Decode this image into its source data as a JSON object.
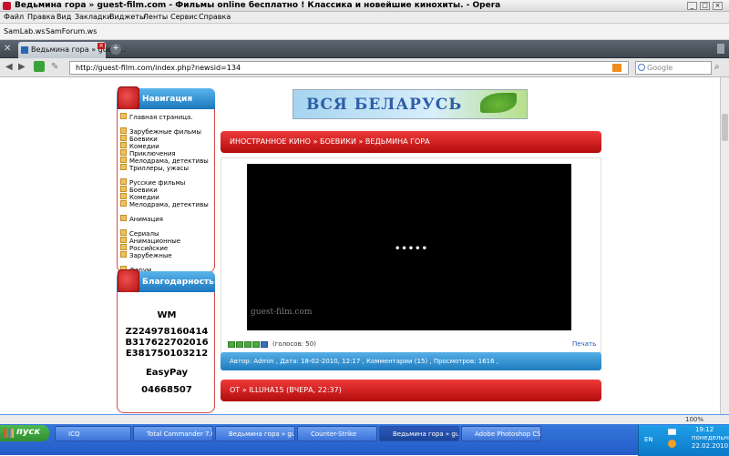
{
  "window": {
    "title": "Ведьмина гора » guest-film.com - Фильмы online бесплатно ! Классика и новейшие кинохиты. - Opera"
  },
  "menu": [
    "Файл",
    "Правка",
    "Вид",
    "Закладки",
    "Виджеты",
    "Ленты",
    "Сервис",
    "Справка"
  ],
  "bookmarks": [
    "SamLab.ws",
    "SamForum.ws"
  ],
  "tab": {
    "label": "Ведьмина гора » guest..."
  },
  "address": {
    "url": "http://guest-film.com/index.php?newsid=134",
    "search_placeholder": "Google"
  },
  "nav": {
    "title": "Навигация",
    "items": [
      "Главная страница.",
      "",
      "Зарубежные фильмы",
      "Боевики",
      "Комедии",
      "Приключения",
      "Мелодрама, детективы",
      "Триллеры, ужасы",
      "",
      "Русские фильмы",
      "Боевики",
      "Комедии",
      "Мелодрама, детективы",
      "",
      "Анимация",
      "",
      "Сериалы",
      "Анимационные",
      "Российские",
      "Зарубежные",
      "",
      "Форум"
    ]
  },
  "thanks": {
    "title": "Благодарность",
    "wm": "WM",
    "purse1": "Z224978160414",
    "purse2": "B317622702016",
    "purse3": "E381750103212",
    "easypay": "EasyPay",
    "easypay_num": "04668507"
  },
  "banner": {
    "text": "ВСЯ БЕЛАРУСЬ"
  },
  "breadcrumb": "ИНОСТРАННОЕ КИНО » БОЕВИКИ » ВЕДЬМИНА ГОРА",
  "video": {
    "loading": "•••••",
    "watermark": "guest-film.com"
  },
  "rating": {
    "votes": "(голосов: 50)",
    "print": "Печать",
    "stars": 5
  },
  "meta": "Автор: Admin , Дата: 18-02-2010, 12:17 , Комментарии (15) , Просмотров: 1616 ,",
  "comment_bar": "ОТ » ILLUHA15 (ВЧЕРА, 22:37)",
  "status": {
    "zoom": "100%"
  },
  "taskbar": {
    "start": "пуск",
    "tasks": [
      "ICQ",
      "Total Commander 7.0...",
      "Ведьмина гора » gu...",
      "Counter-Strike",
      "Ведьмина гора » gu...",
      "Adobe Photoshop CS4"
    ],
    "lang": "EN",
    "time": "19:12",
    "day": "понедельник",
    "date": "22.02.2010"
  }
}
